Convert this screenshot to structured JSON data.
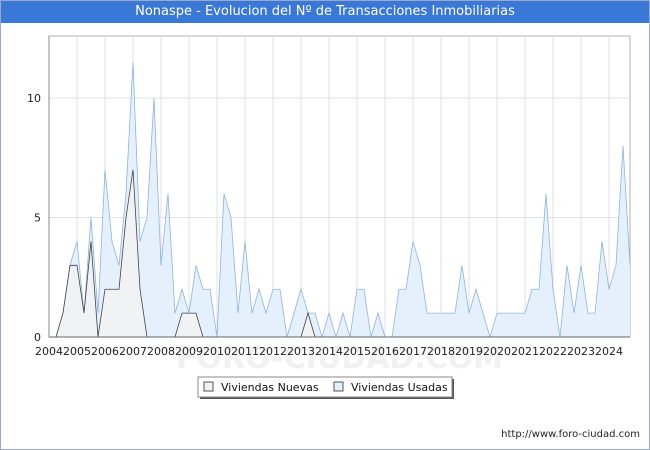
{
  "header": {
    "title": "Nonaspe - Evolucion del Nº de Transacciones Inmobiliarias"
  },
  "footer": {
    "url": "http://www.foro-ciudad.com"
  },
  "watermark": "FORO-CIUDAD.COM",
  "chart_data": {
    "type": "area",
    "title": "Nonaspe - Evolucion del Nº de Transacciones Inmobiliarias",
    "xlabel": "",
    "ylabel": "",
    "xlim": [
      2004,
      2024.75
    ],
    "ylim": [
      0,
      12.6
    ],
    "x_ticks": [
      "2004",
      "2005",
      "2006",
      "2007",
      "2008",
      "2009",
      "2010",
      "2011",
      "2012",
      "2013",
      "2014",
      "2015",
      "2016",
      "2017",
      "2018",
      "2019",
      "2020",
      "2021",
      "2022",
      "2023",
      "2024"
    ],
    "y_ticks": [
      "0",
      "5",
      "10"
    ],
    "grid": true,
    "legend_position": "bottom-center",
    "series": [
      {
        "name": "Viviendas Nuevas",
        "color": "#d0d0d0",
        "fill": "#f2f2f2",
        "line": "#444444",
        "points": [
          [
            2004.0,
            0
          ],
          [
            2004.25,
            0
          ],
          [
            2004.5,
            1
          ],
          [
            2004.75,
            3
          ],
          [
            2005.0,
            3
          ],
          [
            2005.25,
            1
          ],
          [
            2005.5,
            4
          ],
          [
            2005.75,
            0
          ],
          [
            2006.0,
            2
          ],
          [
            2006.25,
            2
          ],
          [
            2006.5,
            2
          ],
          [
            2006.75,
            5
          ],
          [
            2007.0,
            7
          ],
          [
            2007.25,
            2
          ],
          [
            2007.5,
            0
          ],
          [
            2007.75,
            0
          ],
          [
            2008.0,
            0
          ],
          [
            2008.25,
            0
          ],
          [
            2008.5,
            0
          ],
          [
            2008.75,
            1
          ],
          [
            2009.0,
            1
          ],
          [
            2009.25,
            1
          ],
          [
            2009.5,
            0
          ],
          [
            2009.75,
            0
          ],
          [
            2010.0,
            0
          ],
          [
            2010.25,
            0
          ],
          [
            2010.5,
            0
          ],
          [
            2010.75,
            0
          ],
          [
            2011.0,
            0
          ],
          [
            2011.25,
            0
          ],
          [
            2011.5,
            0
          ],
          [
            2011.75,
            0
          ],
          [
            2012.0,
            0
          ],
          [
            2012.25,
            0
          ],
          [
            2012.5,
            0
          ],
          [
            2012.75,
            0
          ],
          [
            2013.0,
            0
          ],
          [
            2013.25,
            1
          ],
          [
            2013.5,
            0
          ],
          [
            2013.75,
            0
          ],
          [
            2014.0,
            0
          ],
          [
            2014.25,
            0
          ],
          [
            2014.5,
            0
          ],
          [
            2014.75,
            0
          ],
          [
            2015.0,
            0
          ],
          [
            2015.25,
            0
          ],
          [
            2015.5,
            0
          ],
          [
            2015.75,
            0
          ],
          [
            2016.0,
            0
          ],
          [
            2016.25,
            0
          ],
          [
            2016.5,
            0
          ],
          [
            2016.75,
            0
          ],
          [
            2017.0,
            0
          ],
          [
            2017.25,
            0
          ],
          [
            2017.5,
            0
          ],
          [
            2017.75,
            0
          ],
          [
            2018.0,
            0
          ],
          [
            2018.25,
            0
          ],
          [
            2018.5,
            0
          ],
          [
            2018.75,
            0
          ],
          [
            2019.0,
            0
          ],
          [
            2019.25,
            0
          ],
          [
            2019.5,
            0
          ],
          [
            2019.75,
            0
          ],
          [
            2020.0,
            0
          ],
          [
            2020.25,
            0
          ],
          [
            2020.5,
            0
          ],
          [
            2020.75,
            0
          ],
          [
            2021.0,
            0
          ],
          [
            2021.25,
            0
          ],
          [
            2021.5,
            0
          ],
          [
            2021.75,
            0
          ],
          [
            2022.0,
            0
          ],
          [
            2022.25,
            0
          ],
          [
            2022.5,
            0
          ],
          [
            2022.75,
            0
          ],
          [
            2023.0,
            0
          ],
          [
            2023.25,
            0
          ],
          [
            2023.5,
            0
          ],
          [
            2023.75,
            0
          ],
          [
            2024.0,
            0
          ],
          [
            2024.25,
            0
          ],
          [
            2024.5,
            0
          ],
          [
            2024.75,
            0
          ]
        ]
      },
      {
        "name": "Viviendas Usadas",
        "color": "#a9c8ec",
        "fill": "#e3f0fc",
        "line": "#8fb3df",
        "points": [
          [
            2004.0,
            0
          ],
          [
            2004.25,
            0
          ],
          [
            2004.5,
            1
          ],
          [
            2004.75,
            3
          ],
          [
            2005.0,
            4
          ],
          [
            2005.25,
            1
          ],
          [
            2005.5,
            5
          ],
          [
            2005.75,
            1
          ],
          [
            2006.0,
            7
          ],
          [
            2006.25,
            4
          ],
          [
            2006.5,
            3
          ],
          [
            2006.75,
            6
          ],
          [
            2007.0,
            11.5
          ],
          [
            2007.25,
            4
          ],
          [
            2007.5,
            5
          ],
          [
            2007.75,
            10
          ],
          [
            2008.0,
            3
          ],
          [
            2008.25,
            6
          ],
          [
            2008.5,
            1
          ],
          [
            2008.75,
            2
          ],
          [
            2009.0,
            1
          ],
          [
            2009.25,
            3
          ],
          [
            2009.5,
            2
          ],
          [
            2009.75,
            2
          ],
          [
            2010.0,
            0
          ],
          [
            2010.25,
            6
          ],
          [
            2010.5,
            5
          ],
          [
            2010.75,
            1
          ],
          [
            2011.0,
            4
          ],
          [
            2011.25,
            1
          ],
          [
            2011.5,
            2
          ],
          [
            2011.75,
            1
          ],
          [
            2012.0,
            2
          ],
          [
            2012.25,
            2
          ],
          [
            2012.5,
            0
          ],
          [
            2012.75,
            1
          ],
          [
            2013.0,
            2
          ],
          [
            2013.25,
            1
          ],
          [
            2013.5,
            1
          ],
          [
            2013.75,
            0
          ],
          [
            2014.0,
            1
          ],
          [
            2014.25,
            0
          ],
          [
            2014.5,
            1
          ],
          [
            2014.75,
            0
          ],
          [
            2015.0,
            2
          ],
          [
            2015.25,
            2
          ],
          [
            2015.5,
            0
          ],
          [
            2015.75,
            1
          ],
          [
            2016.0,
            0
          ],
          [
            2016.25,
            0
          ],
          [
            2016.5,
            2
          ],
          [
            2016.75,
            2
          ],
          [
            2017.0,
            4
          ],
          [
            2017.25,
            3
          ],
          [
            2017.5,
            1
          ],
          [
            2017.75,
            1
          ],
          [
            2018.0,
            1
          ],
          [
            2018.25,
            1
          ],
          [
            2018.5,
            1
          ],
          [
            2018.75,
            3
          ],
          [
            2019.0,
            1
          ],
          [
            2019.25,
            2
          ],
          [
            2019.5,
            1
          ],
          [
            2019.75,
            0
          ],
          [
            2020.0,
            1
          ],
          [
            2020.25,
            1
          ],
          [
            2020.5,
            1
          ],
          [
            2020.75,
            1
          ],
          [
            2021.0,
            1
          ],
          [
            2021.25,
            2
          ],
          [
            2021.5,
            2
          ],
          [
            2021.75,
            6
          ],
          [
            2022.0,
            2
          ],
          [
            2022.25,
            0
          ],
          [
            2022.5,
            3
          ],
          [
            2022.75,
            1
          ],
          [
            2023.0,
            3
          ],
          [
            2023.25,
            1
          ],
          [
            2023.5,
            1
          ],
          [
            2023.75,
            4
          ],
          [
            2024.0,
            2
          ],
          [
            2024.25,
            3
          ],
          [
            2024.5,
            8
          ],
          [
            2024.75,
            3
          ]
        ]
      }
    ]
  }
}
